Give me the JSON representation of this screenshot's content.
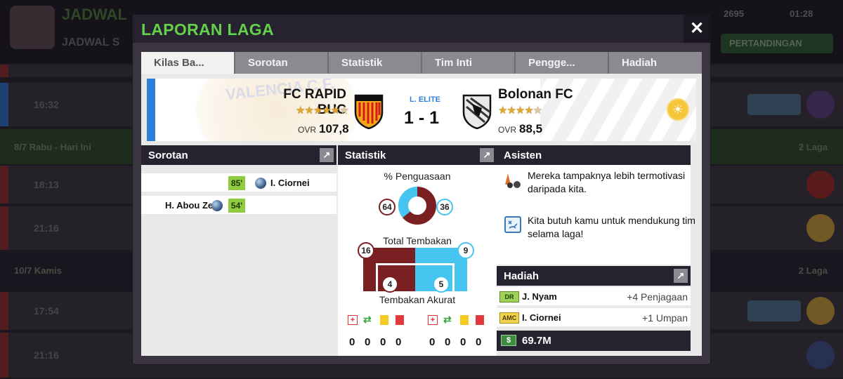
{
  "background": {
    "title": "JADWAL",
    "subtitle": "JADWAL S",
    "stat1": "2695",
    "stat2": "01:28",
    "button_right": "PERTANDINGAN",
    "rows": [
      {
        "time": "16:32"
      },
      {
        "group": "8/7 Rabu - Hari Ini",
        "count": "2 Laga"
      },
      {
        "time": "18:13"
      },
      {
        "time": "21:16"
      },
      {
        "group": "10/7 Kamis",
        "count": "2 Laga"
      },
      {
        "time": "17:54"
      },
      {
        "time": "21:16"
      }
    ]
  },
  "modal": {
    "title": "LAPORAN LAGA",
    "close_icon": "close-icon"
  },
  "tabs": [
    {
      "label": "Kilas Ba...",
      "active": true
    },
    {
      "label": "Sorotan",
      "active": false
    },
    {
      "label": "Statistik",
      "active": false
    },
    {
      "label": "Tim Inti",
      "active": false
    },
    {
      "label": "Pengge...",
      "active": false
    },
    {
      "label": "Hadiah",
      "active": false
    }
  ],
  "match": {
    "home": {
      "name": "FC RAPID BUC",
      "ovr_label": "OVR",
      "ovr": "107,8",
      "stars": 4.5
    },
    "away": {
      "name": "Bolonan FC",
      "ovr_label": "OVR",
      "ovr": "88,5",
      "stars": 3.5
    },
    "league": "L. ELITE",
    "score": "1 - 1",
    "home_watermark": "VALENCIA C.F.",
    "weather_icon": "sun-icon"
  },
  "sorotan": {
    "title": "Sorotan",
    "events": [
      {
        "side": "home",
        "minute": "85'",
        "player": "I. Ciornei"
      },
      {
        "side": "away",
        "minute": "54'",
        "player": "H. Abou Zeid"
      }
    ]
  },
  "statistik": {
    "title": "Statistik",
    "possession_label": "% Penguasaan",
    "possession": {
      "home": 64,
      "away": 36
    },
    "shots_label": "Total Tembakan",
    "shots": {
      "home": 16,
      "away": 9
    },
    "on_target_label": "Tembakan Akurat",
    "on_target": {
      "home": 4,
      "away": 5
    },
    "discipline": {
      "home": {
        "injuries": "0",
        "substitutions": "0",
        "yellow": "0",
        "red": "0"
      },
      "away": {
        "injuries": "0",
        "substitutions": "0",
        "yellow": "0",
        "red": "0"
      }
    },
    "colors": {
      "home": "#7a1f22",
      "away": "#45c5ef"
    }
  },
  "asisten": {
    "title": "Asisten",
    "messages": [
      {
        "icon": "training-cones-icon",
        "text": "Mereka tampaknya lebih termotivasi daripada kita."
      },
      {
        "icon": "tactics-board-icon",
        "text": "Kita butuh kamu untuk mendukung tim selama laga!"
      }
    ]
  },
  "hadiah": {
    "title": "Hadiah",
    "items": [
      {
        "position": "DR",
        "player": "J. Nyam",
        "reward": "+4 Penjagaan"
      },
      {
        "position": "AMC",
        "player": "I. Ciornei",
        "reward": "+1 Umpan"
      }
    ],
    "money": "69.7M"
  }
}
